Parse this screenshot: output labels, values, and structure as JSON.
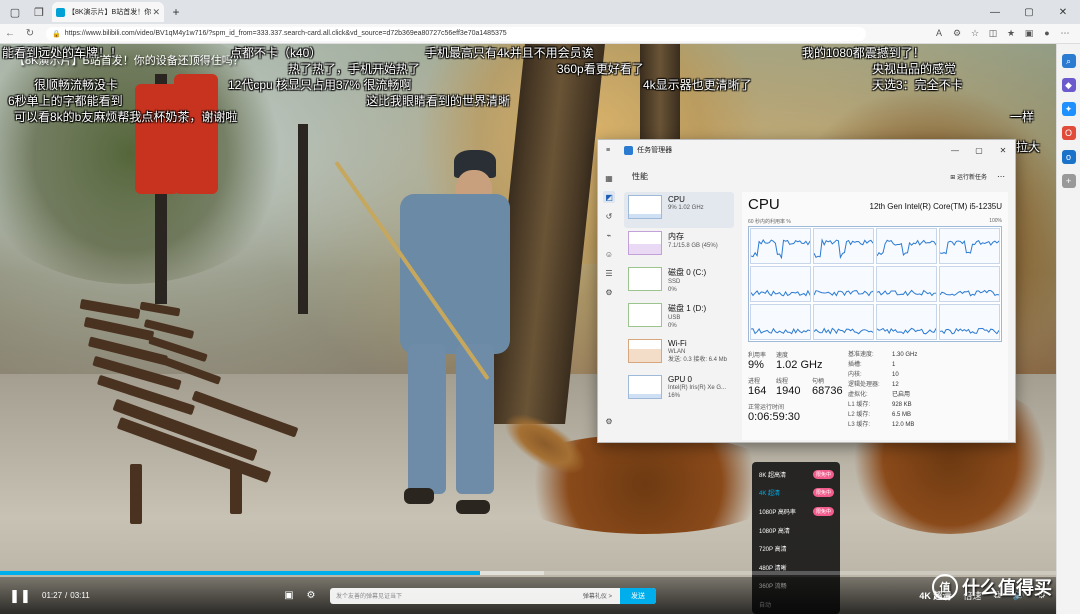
{
  "browser": {
    "tab_title": "【8K演示片】B站首发！你",
    "url": "https://www.bilibili.com/video/BV1qM4y1w716/?spm_id_from=333.337.search-card.all.click&vd_source=d72b369ea80727c56eff3e70a1485375",
    "lock_icon": "lock-icon"
  },
  "video": {
    "title": "【8K演示片】B站首发！你的设备还顶得住吗？",
    "danmaku": [
      "能看到远处的车牌！！",
      "点都不卡（k40）",
      "手机最高只有4k并且不用会员诶",
      "我的1080都震撼到了！",
      "热了热了，手机开始热了",
      "360p看更好看了",
      "央视出品的感觉",
      "很顺畅流畅没卡",
      "12代cpu 核显只占用37% 很流畅啊",
      "4k显示器也更清晰了",
      "天选3：完全不卡",
      "6秒单上的字都能看到",
      "这比我眼睛看到的世界清晰",
      "可以看8k的b友麻烦帮我点杯奶茶，谢谢啦",
      "一样",
      "拉大"
    ]
  },
  "taskmgr": {
    "window_title": "任务管理器",
    "page_title": "性能",
    "run_task": "运行新任务",
    "items": [
      {
        "name": "CPU",
        "sub": "9%  1.02 GHz",
        "sub2": ""
      },
      {
        "name": "内存",
        "sub": "7.1/15.8 GB (45%)",
        "sub2": ""
      },
      {
        "name": "磁盘 0 (C:)",
        "sub": "SSD",
        "sub2": "0%"
      },
      {
        "name": "磁盘 1 (D:)",
        "sub": "USB",
        "sub2": "0%"
      },
      {
        "name": "Wi-Fi",
        "sub": "WLAN",
        "sub2": "发送: 0.3 接收: 6.4 Mb"
      },
      {
        "name": "GPU 0",
        "sub": "Intel(R) Iris(R) Xe G...",
        "sub2": "16%"
      }
    ],
    "cpu_title": "CPU",
    "cpu_model": "12th Gen Intel(R) Core(TM) i5-1235U",
    "graph_label": "60 秒内的利用率 %",
    "graph_max": "100%",
    "stats": {
      "util_label": "利用率",
      "util": "9%",
      "speed_label": "速度",
      "speed": "1.02 GHz",
      "proc_label": "进程",
      "proc": "164",
      "thread_label": "线程",
      "thread": "1940",
      "handle_label": "句柄",
      "handle": "68736",
      "uptime_label": "正常运行时间",
      "uptime": "0:06:59:30"
    },
    "specs": [
      {
        "k": "基准速度:",
        "v": "1.30 GHz"
      },
      {
        "k": "插槽:",
        "v": "1"
      },
      {
        "k": "内核:",
        "v": "10"
      },
      {
        "k": "逻辑处理器:",
        "v": "12"
      },
      {
        "k": "虚拟化:",
        "v": "已启用"
      },
      {
        "k": "L1 缓存:",
        "v": "928 KB"
      },
      {
        "k": "L2 缓存:",
        "v": "6.5 MB"
      },
      {
        "k": "L3 缓存:",
        "v": "12.0 MB"
      }
    ]
  },
  "quality_menu": {
    "items": [
      {
        "label": "8K 超高清",
        "badge": "限免中"
      },
      {
        "label": "4K 超清",
        "badge": "限免中"
      },
      {
        "label": "1080P 高码率",
        "badge": "限免中"
      },
      {
        "label": "1080P 高清",
        "badge": ""
      },
      {
        "label": "720P 高清",
        "badge": ""
      },
      {
        "label": "480P 清晰",
        "badge": ""
      },
      {
        "label": "360P 流畅",
        "badge": ""
      },
      {
        "label": "自动",
        "badge": ""
      }
    ],
    "active_index": 1
  },
  "player": {
    "current_time": "01:27",
    "duration": "03:11",
    "played_fraction": 0.455,
    "buffered_fraction": 0.515,
    "danmaku_placeholder": "发个友善的弹幕见证当下",
    "etiquette": "弹幕礼仪 >",
    "send": "发送",
    "quality": "4K 超清",
    "speed": "倍速"
  },
  "watermark": "什么值得买",
  "colors": {
    "bili_blue": "#00aeec",
    "badge_pink": "#f25d8e"
  }
}
